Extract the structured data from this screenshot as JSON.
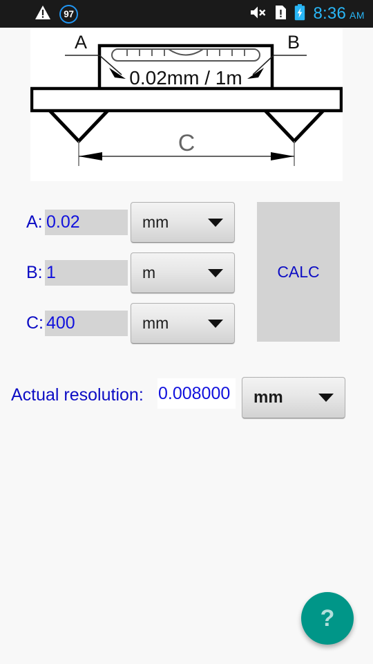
{
  "status_bar": {
    "warning_icon": "warning-triangle-icon",
    "notification_count": "97",
    "mute_icon": "volume-mute-icon",
    "document_alert_icon": "document-alert-icon",
    "battery_icon": "battery-charging-icon",
    "time": "8:36",
    "ampm": "AM",
    "accent_color": "#29b6f6",
    "background_color": "#1a1a1a"
  },
  "diagram": {
    "name": "spirit-level-diagram",
    "label_a": "A",
    "label_b": "B",
    "sensitivity_text": "0.02mm / 1m",
    "dimension_label": "C"
  },
  "form": {
    "rows": [
      {
        "label": "A:",
        "value": "0.02",
        "unit": "mm"
      },
      {
        "label": "B:",
        "value": "1",
        "unit": "m"
      },
      {
        "label": "C:",
        "value": "400",
        "unit": "mm"
      }
    ]
  },
  "calc_button": {
    "label": "CALC"
  },
  "result": {
    "label": "Actual resolution:",
    "value": "0.008000",
    "unit": "mm"
  },
  "fab": {
    "icon": "question-mark-icon",
    "label": "?",
    "color": "#009688"
  },
  "colors": {
    "text_blue": "#0d0dc4",
    "value_blue": "#1111dd",
    "field_gray": "#d4d4d4",
    "page_background": "#f8f8f8"
  }
}
